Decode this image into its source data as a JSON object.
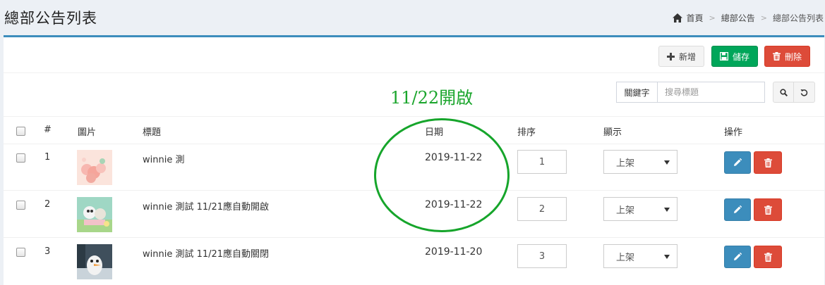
{
  "page": {
    "title": "總部公告列表"
  },
  "breadcrumb": {
    "home": "首頁",
    "mid": "總部公告",
    "current": "總部公告列表",
    "sep": ">"
  },
  "toolbar": {
    "add_label": "新增",
    "save_label": "儲存",
    "delete_label": "刪除"
  },
  "notice": "11/22開啟",
  "search": {
    "label": "關鍵字",
    "placeholder": "搜尋標題",
    "value": ""
  },
  "table": {
    "headers": {
      "index": "#",
      "image": "圖片",
      "title": "標題",
      "date": "日期",
      "order": "排序",
      "display": "顯示",
      "actions": "操作"
    },
    "rows": [
      {
        "index": "1",
        "title": "winnie 測",
        "date": "2019-11-22",
        "order": "1",
        "display": "上架"
      },
      {
        "index": "2",
        "title": "winnie 測試 11/21應自動開啟",
        "date": "2019-11-22",
        "order": "2",
        "display": "上架"
      },
      {
        "index": "3",
        "title": "winnie 測試 11/21應自動關閉",
        "date": "2019-11-20",
        "order": "3",
        "display": "上架"
      }
    ]
  },
  "colors": {
    "accent": "#3c8dbc",
    "success": "#00a65a",
    "danger": "#dd4b39",
    "annotation": "#16a52b"
  }
}
